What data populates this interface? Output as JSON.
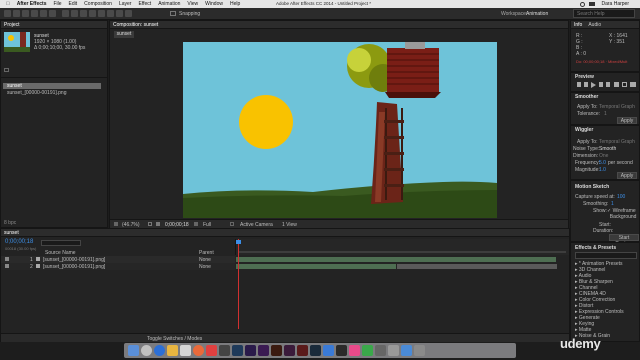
{
  "menubar": {
    "app": "After Effects",
    "items": [
      "File",
      "Edit",
      "Composition",
      "Layer",
      "Effect",
      "Animation",
      "View",
      "Window",
      "Help"
    ],
    "title": "Adobe After Effects CC 2014 - Untitled Project *",
    "user": "Dara Harper"
  },
  "toolbar": {
    "snapping": "Snapping",
    "workspace_label": "Workspace:",
    "workspace_value": "Animation",
    "search_placeholder": "Search Help"
  },
  "project": {
    "tab": "Project",
    "item_name": "sunset",
    "item_info1": "1920 × 1080 (1.00)",
    "item_info2": "Δ 0;00;10;00, 30.00 fps",
    "files": [
      "sunset",
      "sunset_[00000-00191].png"
    ],
    "bpc": "8 bpc"
  },
  "composition": {
    "tab": "Composition: sunset",
    "sub_tab": "sunset",
    "zoom": "(46.7%)",
    "timecode": "0;00;00;18",
    "resolution": "Full",
    "camera": "Active Camera",
    "view": "1 View"
  },
  "info": {
    "tabs": [
      "Info",
      "Audio"
    ],
    "r": "R :",
    "g": "G :",
    "b": "B :",
    "a": "A : 0",
    "x": "X : 1641",
    "y": "Y : 351",
    "warn": "Do: 00;00;00;18 · Mixed/Mult"
  },
  "preview": {
    "title": "Preview"
  },
  "smoother": {
    "title": "Smoother",
    "apply_label": "Apply To:",
    "apply_value": "Temporal Graph",
    "tolerance_label": "Tolerance:",
    "tolerance_value": "1",
    "apply_btn": "Apply"
  },
  "wiggler": {
    "title": "Wiggler",
    "apply_label": "Apply To:",
    "apply_value": "Temporal Graph",
    "noise_label": "Noise Type:",
    "noise_value": "Smooth",
    "dim_label": "Dimension:",
    "dim_value": "One",
    "freq_label": "Frequency:",
    "freq_value": "5.0",
    "freq_unit": "per second",
    "mag_label": "Magnitude:",
    "mag_value": "1.0",
    "apply_btn": "Apply"
  },
  "motion_sketch": {
    "title": "Motion Sketch",
    "capture_label": "Capture speed at:",
    "capture_value": "100",
    "smoothing_label": "Smoothing:",
    "smoothing_value": "1",
    "show_label": "Show:",
    "wireframe": "Wireframe",
    "background": "Background",
    "start_label": "Start:",
    "duration_label": "Duration:",
    "capture_btn": "Start Capture"
  },
  "effects": {
    "title": "Effects & Presets",
    "items": [
      "* Animation Presets",
      "3D Channel",
      "Audio",
      "Blur & Sharpen",
      "Channel",
      "CINEMA 4D",
      "Color Correction",
      "Distort",
      "Expression Controls",
      "Generate",
      "Keying",
      "Matte",
      "Noise & Grain"
    ]
  },
  "timeline": {
    "tab": "sunset",
    "timecode": "0;00;00;18",
    "frame_info": "00018 (30.00 fps)",
    "col_source": "Source Name",
    "col_parent": "Parent",
    "layers": [
      {
        "num": "1",
        "name": "[sunset_[00000-00191].png]",
        "parent": "None"
      },
      {
        "num": "2",
        "name": "[sunset_[00000-00191].png]",
        "parent": "None"
      }
    ],
    "toggle_label": "Toggle Switches / Modes"
  },
  "watermark": "udemy",
  "colors": {
    "sky": "#6ec3d9",
    "sun": "#f9c200",
    "grass": "#3a5a20",
    "timecode_blue": "#3c8ee6",
    "playhead_red": "#d03030"
  }
}
